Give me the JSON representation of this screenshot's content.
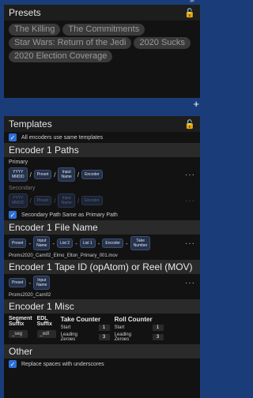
{
  "presets_panel": {
    "collapse": "»×",
    "title": "Presets",
    "chips": [
      "The Killing",
      "The Commitments",
      "Star Wars: Return of the Jedi",
      "2020 Sucks",
      "2020 Election Coverage"
    ],
    "add_label": "+"
  },
  "templates_panel": {
    "collapse": "»×",
    "title": "Templates",
    "all_encoders_label": "All encoders use same templates",
    "paths": {
      "title": "Encoder 1 Paths",
      "primary_label": "Primary",
      "primary_tokens": [
        "YYYY\nMMDD",
        "Preset",
        "Input\nName",
        "Encoder"
      ],
      "secondary_label": "Secondary",
      "secondary_tokens": [
        "YYYY\nMMDD",
        "Preset",
        "Input\nName",
        "Encoder"
      ],
      "same_as_primary_label": "Secondary Path Same as Primary Path"
    },
    "file_name": {
      "title": "Encoder 1 File Name",
      "tokens": [
        "Preset",
        "Input\nName",
        "List 2",
        "List 1",
        "Encoder",
        "Take\nNumber"
      ],
      "example": "Proms2020_Cam02_Elmo_Elton_Primary_001.mov"
    },
    "tape_id": {
      "title": "Encoder 1 Tape ID (opAtom) or Reel (MOV)",
      "tokens": [
        "Preset",
        "Input\nName"
      ],
      "example": "Proms2020_Cam02"
    },
    "misc": {
      "title": "Encoder 1 Misc",
      "segment_suffix_label": "Segment\nSuffix",
      "segment_suffix_value": "_seg",
      "edl_suffix_label": "EDL\nSuffix",
      "edl_suffix_value": "_edl",
      "take_counter": {
        "title": "Take Counter",
        "start_label": "Start",
        "start_value": "1",
        "zeroes_label": "Leading\nZeroes",
        "zeroes_value": "3"
      },
      "roll_counter": {
        "title": "Roll Counter",
        "start_label": "Start",
        "start_value": "1",
        "zeroes_label": "Leading\nZeroes",
        "zeroes_value": "3"
      }
    },
    "other": {
      "title": "Other",
      "replace_spaces_label": "Replace spaces with underscores"
    }
  }
}
